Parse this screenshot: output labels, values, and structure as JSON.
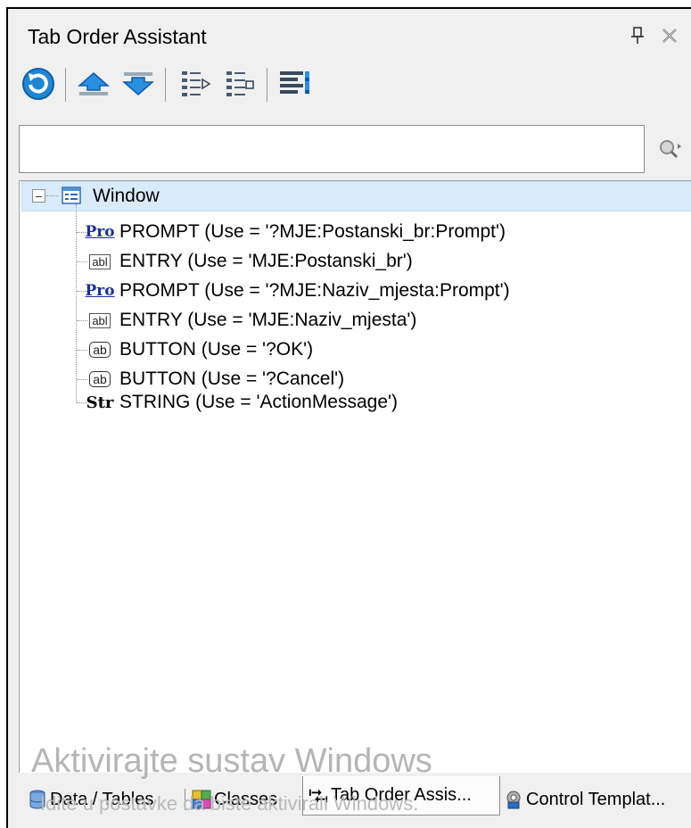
{
  "panel": {
    "title": "Tab Order Assistant",
    "title_buttons": [
      {
        "icon": "pin-icon",
        "glyph": "⊥"
      },
      {
        "icon": "close-icon",
        "glyph": "✕"
      }
    ]
  },
  "toolbar": {
    "items": [
      {
        "icon": "refresh-icon"
      },
      {
        "icon": "move-up-icon"
      },
      {
        "icon": "move-down-icon"
      },
      {
        "icon": "list-order-icon"
      },
      {
        "icon": "list-order-alt-icon"
      },
      {
        "icon": "align-controls-icon"
      }
    ]
  },
  "search": {
    "value": "",
    "placeholder": "",
    "icon": "search-icon"
  },
  "tree": {
    "root": {
      "label": "Window",
      "icon": "window-icon",
      "expanded": true,
      "selected": true
    },
    "children": [
      {
        "type": "PROMPT",
        "icon_text": "Pro",
        "label": "PROMPT (Use = '?MJE:Postanski_br:Prompt')"
      },
      {
        "type": "ENTRY",
        "icon_text": "abl",
        "label": "ENTRY (Use = 'MJE:Postanski_br')"
      },
      {
        "type": "PROMPT",
        "icon_text": "Pro",
        "label": "PROMPT (Use = '?MJE:Naziv_mjesta:Prompt')"
      },
      {
        "type": "ENTRY",
        "icon_text": "abl",
        "label": "ENTRY (Use = 'MJE:Naziv_mjesta')"
      },
      {
        "type": "BUTTON",
        "icon_text": "ab",
        "label": "BUTTON (Use = '?OK')"
      },
      {
        "type": "BUTTON",
        "icon_text": "ab",
        "label": "BUTTON (Use = '?Cancel')"
      },
      {
        "type": "STRING",
        "icon_text": "Str",
        "label": "STRING (Use = 'ActionMessage')"
      }
    ]
  },
  "watermark": {
    "line1": "Aktivirajte sustav Windows",
    "line2": "Idite u postavke da biste aktivirali Windows."
  },
  "tabs": [
    {
      "label": "Data / Tables",
      "icon": "database-icon",
      "active": false
    },
    {
      "label": "Classes",
      "icon": "classes-icon",
      "active": false
    },
    {
      "label": "Tab Order Assis...",
      "icon": "tab-order-icon",
      "active": true
    },
    {
      "label": "Control Templat...",
      "icon": "control-template-icon",
      "active": false
    }
  ],
  "colors": {
    "selection": "#d9ebfb",
    "prompt_icon": "#1a2fa0",
    "accent_blue": "#1f86d6"
  }
}
